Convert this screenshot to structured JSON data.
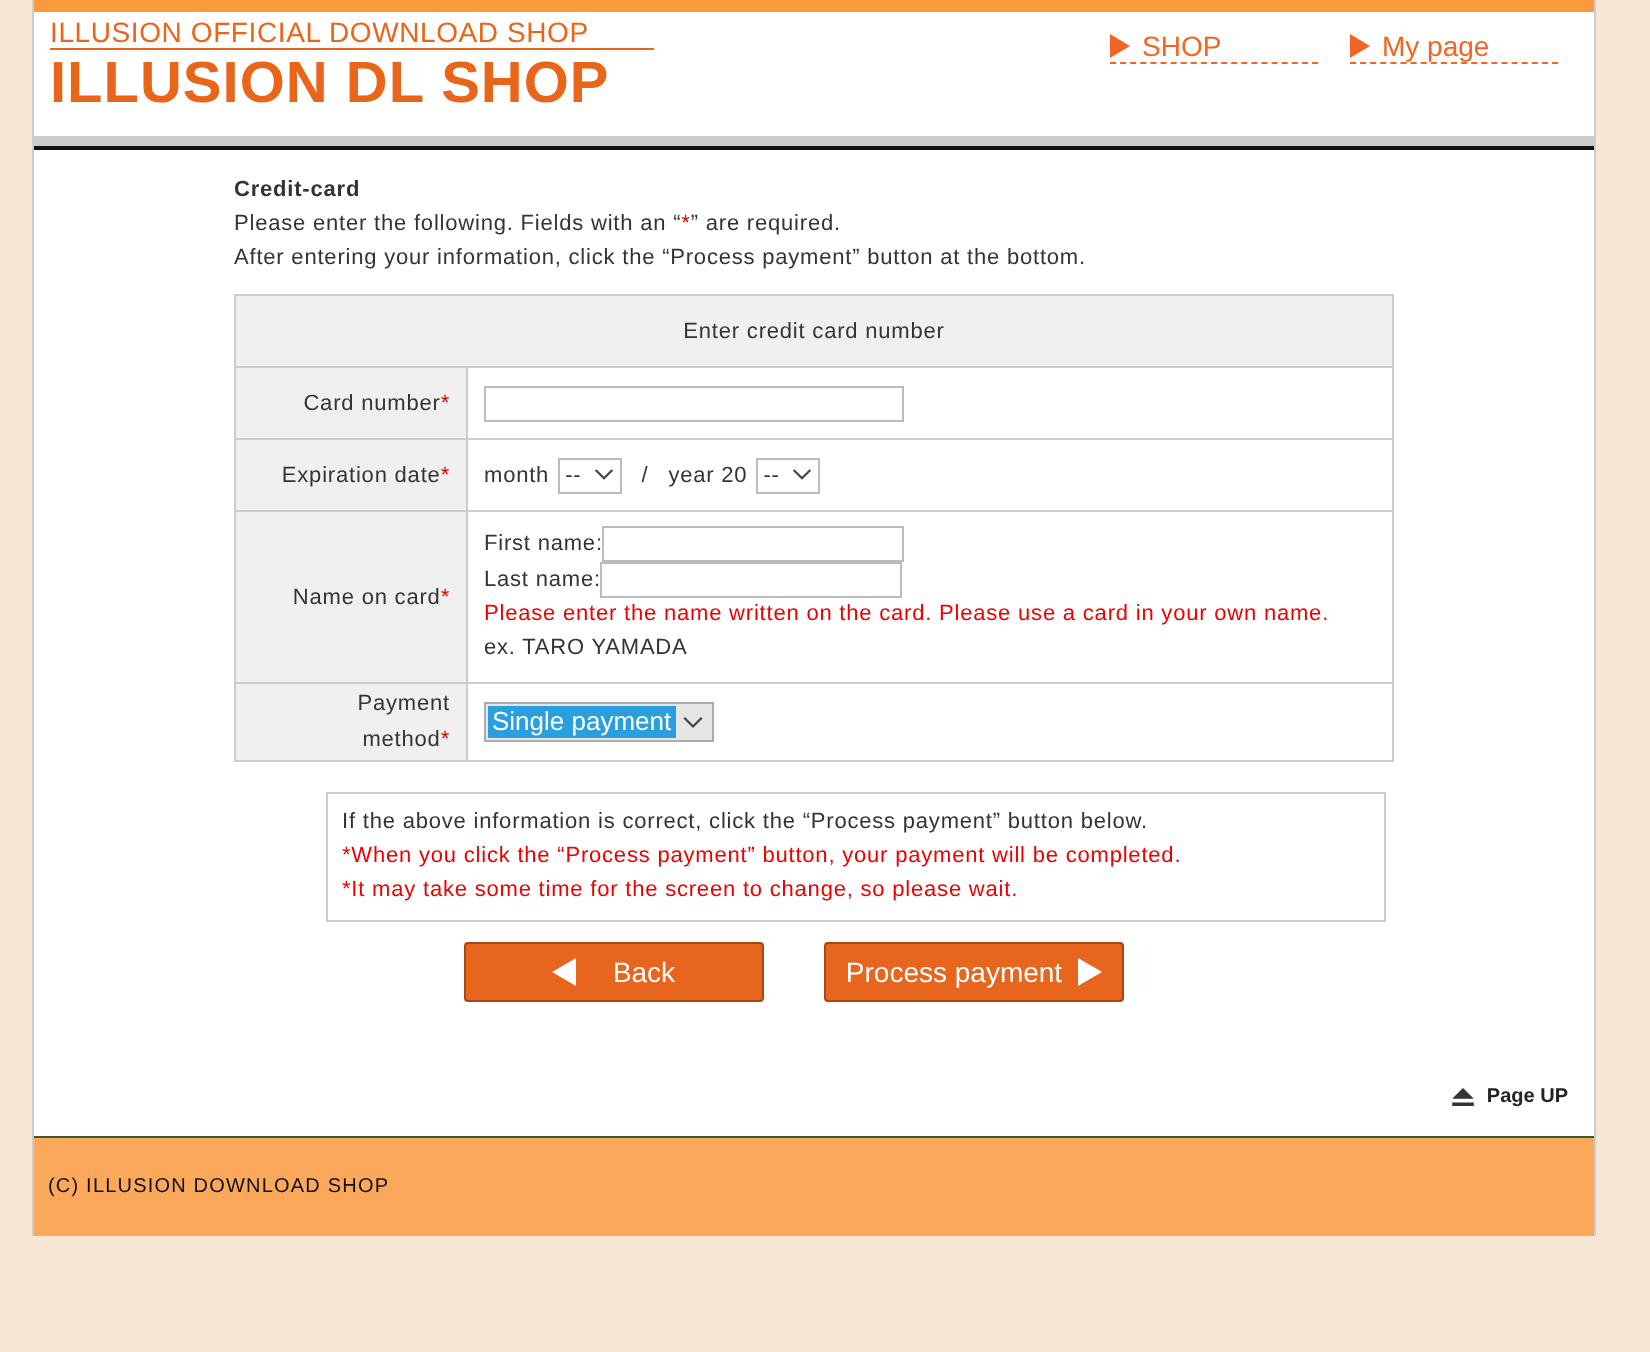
{
  "header": {
    "subtitle": "ILLUSION OFFICIAL DOWNLOAD SHOP",
    "title": "ILLUSION DL SHOP",
    "nav": [
      {
        "label": "SHOP"
      },
      {
        "label": "My page"
      }
    ]
  },
  "intro": {
    "heading": "Credit-card",
    "line1_before": "Please enter the following. Fields with an “",
    "line1_mark": "*",
    "line1_after": "” are required.",
    "line2": "After entering your information, click the “Process payment” button at the bottom."
  },
  "form": {
    "title": "Enter credit card number",
    "required_mark": "*",
    "rows": [
      {
        "kind": "card",
        "label": "Card number",
        "required": true
      },
      {
        "kind": "expiry",
        "label": "Expiration date",
        "required": true,
        "month_label": "month",
        "month_value": "--",
        "separator": "/",
        "year_label": "year 20",
        "year_value": "--"
      },
      {
        "kind": "name",
        "label": "Name on card",
        "required": true,
        "first_label": "First name:",
        "last_label": "Last name:",
        "warning": "Please enter the name written on the card. Please use a card in your own name.",
        "example": "ex. TARO YAMADA"
      },
      {
        "kind": "payment",
        "label": "Payment method",
        "required": true,
        "value": "Single payment"
      }
    ]
  },
  "notice": {
    "lines": [
      {
        "text": "If the above information is correct, click the “Process payment” button below.",
        "warning": false
      },
      {
        "text": "*When you click the “Process payment” button, your payment will be completed.",
        "warning": true
      },
      {
        "text": "*It may take some time for the screen to change, so please wait.",
        "warning": true
      }
    ]
  },
  "buttons": {
    "back": "Back",
    "process": "Process payment"
  },
  "page_up": "Page UP",
  "footer": "(C) ILLUSION DOWNLOAD SHOP"
}
